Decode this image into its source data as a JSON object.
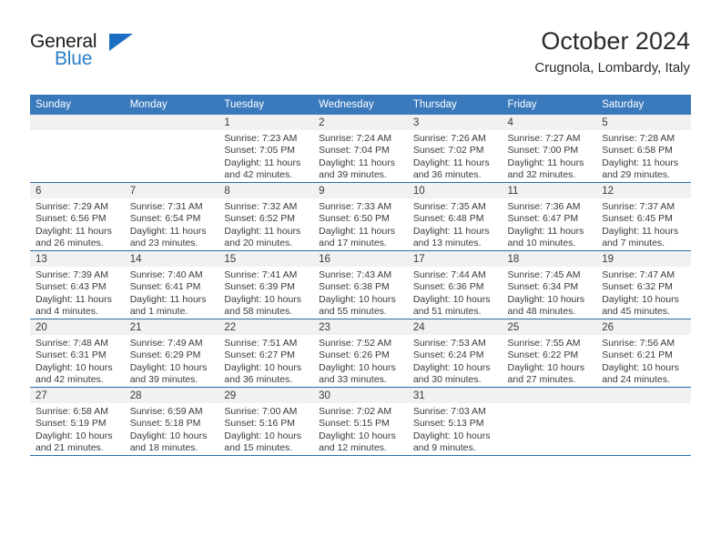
{
  "brand": {
    "name_top": "General",
    "name_bottom": "Blue",
    "triangle_icon": "triangle-icon",
    "accent_color": "#2a7fc9"
  },
  "header": {
    "title": "October 2024",
    "subtitle": "Crugnola, Lombardy, Italy"
  },
  "calendar": {
    "header_color": "#3b79bd",
    "weekdays": [
      "Sunday",
      "Monday",
      "Tuesday",
      "Wednesday",
      "Thursday",
      "Friday",
      "Saturday"
    ],
    "weeks": [
      [
        {
          "day": "",
          "lines": []
        },
        {
          "day": "",
          "lines": []
        },
        {
          "day": "1",
          "lines": [
            "Sunrise: 7:23 AM",
            "Sunset: 7:05 PM",
            "Daylight: 11 hours",
            "and 42 minutes."
          ]
        },
        {
          "day": "2",
          "lines": [
            "Sunrise: 7:24 AM",
            "Sunset: 7:04 PM",
            "Daylight: 11 hours",
            "and 39 minutes."
          ]
        },
        {
          "day": "3",
          "lines": [
            "Sunrise: 7:26 AM",
            "Sunset: 7:02 PM",
            "Daylight: 11 hours",
            "and 36 minutes."
          ]
        },
        {
          "day": "4",
          "lines": [
            "Sunrise: 7:27 AM",
            "Sunset: 7:00 PM",
            "Daylight: 11 hours",
            "and 32 minutes."
          ]
        },
        {
          "day": "5",
          "lines": [
            "Sunrise: 7:28 AM",
            "Sunset: 6:58 PM",
            "Daylight: 11 hours",
            "and 29 minutes."
          ]
        }
      ],
      [
        {
          "day": "6",
          "lines": [
            "Sunrise: 7:29 AM",
            "Sunset: 6:56 PM",
            "Daylight: 11 hours",
            "and 26 minutes."
          ]
        },
        {
          "day": "7",
          "lines": [
            "Sunrise: 7:31 AM",
            "Sunset: 6:54 PM",
            "Daylight: 11 hours",
            "and 23 minutes."
          ]
        },
        {
          "day": "8",
          "lines": [
            "Sunrise: 7:32 AM",
            "Sunset: 6:52 PM",
            "Daylight: 11 hours",
            "and 20 minutes."
          ]
        },
        {
          "day": "9",
          "lines": [
            "Sunrise: 7:33 AM",
            "Sunset: 6:50 PM",
            "Daylight: 11 hours",
            "and 17 minutes."
          ]
        },
        {
          "day": "10",
          "lines": [
            "Sunrise: 7:35 AM",
            "Sunset: 6:48 PM",
            "Daylight: 11 hours",
            "and 13 minutes."
          ]
        },
        {
          "day": "11",
          "lines": [
            "Sunrise: 7:36 AM",
            "Sunset: 6:47 PM",
            "Daylight: 11 hours",
            "and 10 minutes."
          ]
        },
        {
          "day": "12",
          "lines": [
            "Sunrise: 7:37 AM",
            "Sunset: 6:45 PM",
            "Daylight: 11 hours",
            "and 7 minutes."
          ]
        }
      ],
      [
        {
          "day": "13",
          "lines": [
            "Sunrise: 7:39 AM",
            "Sunset: 6:43 PM",
            "Daylight: 11 hours",
            "and 4 minutes."
          ]
        },
        {
          "day": "14",
          "lines": [
            "Sunrise: 7:40 AM",
            "Sunset: 6:41 PM",
            "Daylight: 11 hours",
            "and 1 minute."
          ]
        },
        {
          "day": "15",
          "lines": [
            "Sunrise: 7:41 AM",
            "Sunset: 6:39 PM",
            "Daylight: 10 hours",
            "and 58 minutes."
          ]
        },
        {
          "day": "16",
          "lines": [
            "Sunrise: 7:43 AM",
            "Sunset: 6:38 PM",
            "Daylight: 10 hours",
            "and 55 minutes."
          ]
        },
        {
          "day": "17",
          "lines": [
            "Sunrise: 7:44 AM",
            "Sunset: 6:36 PM",
            "Daylight: 10 hours",
            "and 51 minutes."
          ]
        },
        {
          "day": "18",
          "lines": [
            "Sunrise: 7:45 AM",
            "Sunset: 6:34 PM",
            "Daylight: 10 hours",
            "and 48 minutes."
          ]
        },
        {
          "day": "19",
          "lines": [
            "Sunrise: 7:47 AM",
            "Sunset: 6:32 PM",
            "Daylight: 10 hours",
            "and 45 minutes."
          ]
        }
      ],
      [
        {
          "day": "20",
          "lines": [
            "Sunrise: 7:48 AM",
            "Sunset: 6:31 PM",
            "Daylight: 10 hours",
            "and 42 minutes."
          ]
        },
        {
          "day": "21",
          "lines": [
            "Sunrise: 7:49 AM",
            "Sunset: 6:29 PM",
            "Daylight: 10 hours",
            "and 39 minutes."
          ]
        },
        {
          "day": "22",
          "lines": [
            "Sunrise: 7:51 AM",
            "Sunset: 6:27 PM",
            "Daylight: 10 hours",
            "and 36 minutes."
          ]
        },
        {
          "day": "23",
          "lines": [
            "Sunrise: 7:52 AM",
            "Sunset: 6:26 PM",
            "Daylight: 10 hours",
            "and 33 minutes."
          ]
        },
        {
          "day": "24",
          "lines": [
            "Sunrise: 7:53 AM",
            "Sunset: 6:24 PM",
            "Daylight: 10 hours",
            "and 30 minutes."
          ]
        },
        {
          "day": "25",
          "lines": [
            "Sunrise: 7:55 AM",
            "Sunset: 6:22 PM",
            "Daylight: 10 hours",
            "and 27 minutes."
          ]
        },
        {
          "day": "26",
          "lines": [
            "Sunrise: 7:56 AM",
            "Sunset: 6:21 PM",
            "Daylight: 10 hours",
            "and 24 minutes."
          ]
        }
      ],
      [
        {
          "day": "27",
          "lines": [
            "Sunrise: 6:58 AM",
            "Sunset: 5:19 PM",
            "Daylight: 10 hours",
            "and 21 minutes."
          ]
        },
        {
          "day": "28",
          "lines": [
            "Sunrise: 6:59 AM",
            "Sunset: 5:18 PM",
            "Daylight: 10 hours",
            "and 18 minutes."
          ]
        },
        {
          "day": "29",
          "lines": [
            "Sunrise: 7:00 AM",
            "Sunset: 5:16 PM",
            "Daylight: 10 hours",
            "and 15 minutes."
          ]
        },
        {
          "day": "30",
          "lines": [
            "Sunrise: 7:02 AM",
            "Sunset: 5:15 PM",
            "Daylight: 10 hours",
            "and 12 minutes."
          ]
        },
        {
          "day": "31",
          "lines": [
            "Sunrise: 7:03 AM",
            "Sunset: 5:13 PM",
            "Daylight: 10 hours",
            "and 9 minutes."
          ]
        },
        {
          "day": "",
          "lines": []
        },
        {
          "day": "",
          "lines": []
        }
      ]
    ]
  }
}
